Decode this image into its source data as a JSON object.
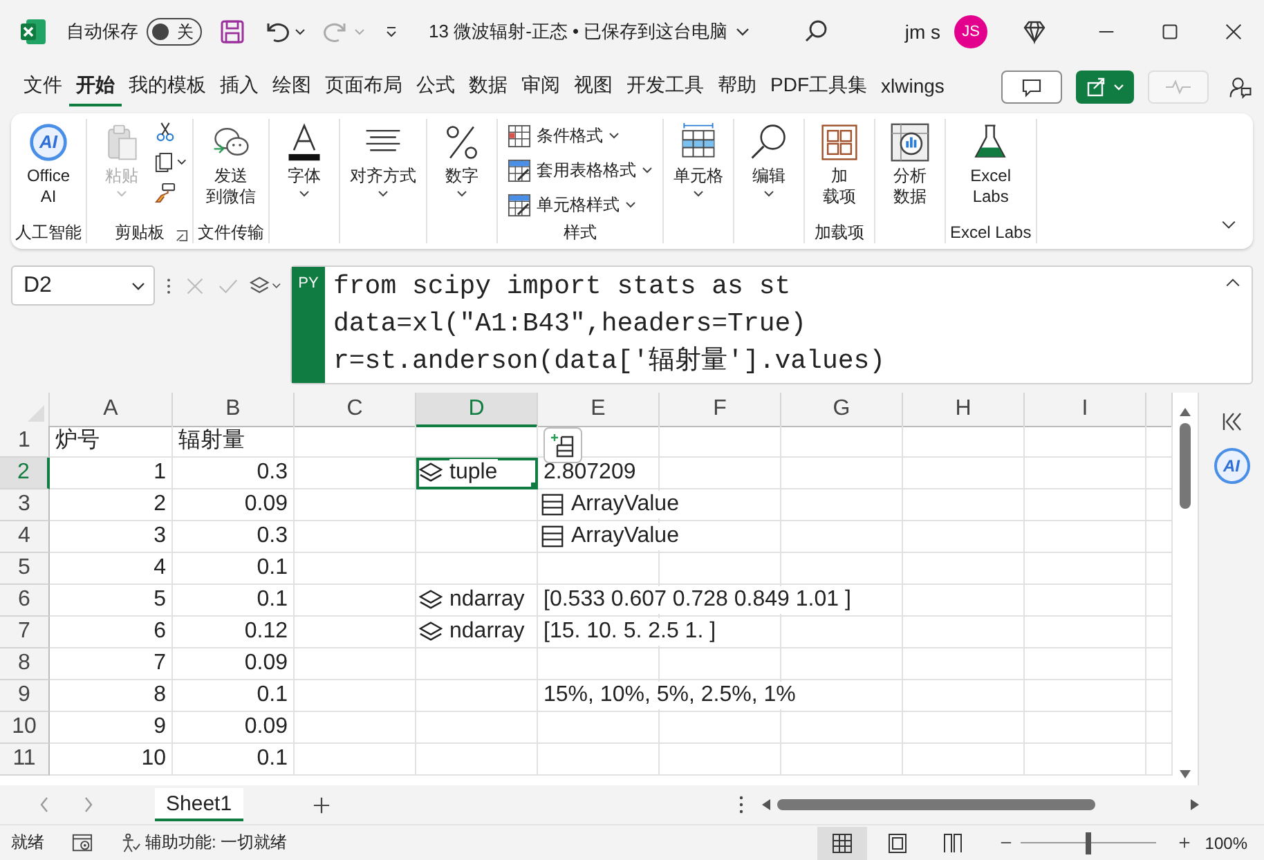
{
  "title_bar": {
    "autosave_label": "自动保存",
    "autosave": {
      "label": "关",
      "on": false
    },
    "document_title": "13 微波辐射-正态 • 已保存到这台电脑",
    "user_name": "jm s",
    "avatar": "JS"
  },
  "menu_tabs": [
    {
      "label": "文件",
      "selected": false
    },
    {
      "label": "开始",
      "selected": true
    },
    {
      "label": "我的模板",
      "selected": false
    },
    {
      "label": "插入",
      "selected": false
    },
    {
      "label": "绘图",
      "selected": false
    },
    {
      "label": "页面布局",
      "selected": false
    },
    {
      "label": "公式",
      "selected": false
    },
    {
      "label": "数据",
      "selected": false
    },
    {
      "label": "审阅",
      "selected": false
    },
    {
      "label": "视图",
      "selected": false
    },
    {
      "label": "开发工具",
      "selected": false
    },
    {
      "label": "帮助",
      "selected": false
    },
    {
      "label": "PDF工具集",
      "selected": false
    },
    {
      "label": "xlwings",
      "selected": false
    }
  ],
  "ribbon": {
    "groups": [
      {
        "label": "人工智能",
        "buttons": [
          {
            "lines": [
              "Office",
              "AI"
            ],
            "badge": "AI",
            "dropdown": false,
            "disabled": false
          }
        ]
      },
      {
        "label": "剪贴板",
        "buttons": [
          {
            "lines": [
              "粘贴"
            ],
            "dropdown": true,
            "disabled": true
          }
        ]
      },
      {
        "label": "文件传输",
        "buttons": [
          {
            "lines": [
              "发送",
              "到微信"
            ],
            "dropdown": false,
            "disabled": false
          }
        ]
      },
      {
        "buttons": [
          {
            "lines": [
              "字体"
            ],
            "dropdown": true,
            "disabled": false
          }
        ]
      },
      {
        "buttons": [
          {
            "lines": [
              "对齐方式"
            ],
            "dropdown": true,
            "disabled": false
          }
        ]
      },
      {
        "buttons": [
          {
            "lines": [
              "数字"
            ],
            "dropdown": true,
            "disabled": false
          }
        ]
      },
      {
        "label": "样式",
        "buttons": [
          {
            "lines": [
              "条件格式"
            ],
            "dropdown": true,
            "disabled": false
          },
          {
            "lines": [
              "套用表格格式"
            ],
            "dropdown": true,
            "disabled": false
          },
          {
            "lines": [
              "单元格样式"
            ],
            "dropdown": true,
            "disabled": false
          }
        ]
      },
      {
        "buttons": [
          {
            "lines": [
              "单元格"
            ],
            "dropdown": true,
            "disabled": false
          }
        ]
      },
      {
        "buttons": [
          {
            "lines": [
              "编辑"
            ],
            "dropdown": true,
            "disabled": false
          }
        ]
      },
      {
        "label": "加载项",
        "buttons": [
          {
            "lines": [
              "加",
              "载项"
            ],
            "dropdown": false,
            "disabled": false
          }
        ]
      },
      {
        "buttons": [
          {
            "lines": [
              "分析",
              "数据"
            ],
            "dropdown": false,
            "disabled": false
          }
        ]
      },
      {
        "label": "Excel Labs",
        "buttons": [
          {
            "lines": [
              "Excel",
              "Labs"
            ],
            "dropdown": false,
            "disabled": false
          }
        ]
      }
    ]
  },
  "formula_bar": {
    "name_box": "D2",
    "badge": "PY",
    "code_lines": [
      "from scipy import stats as st",
      "data=xl(\"A1:B43\",headers=True)",
      "r=st.anderson(data['辐射量'].values)"
    ]
  },
  "columns": [
    {
      "label": "A",
      "selected": false
    },
    {
      "label": "B",
      "selected": false
    },
    {
      "label": "C",
      "selected": false
    },
    {
      "label": "D",
      "selected": true
    },
    {
      "label": "E",
      "selected": false
    },
    {
      "label": "F",
      "selected": false
    },
    {
      "label": "G",
      "selected": false
    },
    {
      "label": "H",
      "selected": false
    },
    {
      "label": "I",
      "selected": false
    }
  ],
  "rows": [
    {
      "header": "1",
      "selected": false,
      "cells": [
        {
          "kind": "text",
          "text": "炉号"
        },
        {
          "kind": "text",
          "text": "辐射量"
        },
        {
          "kind": "empty"
        },
        {
          "kind": "empty"
        },
        {
          "kind": "empty"
        },
        {
          "kind": "empty"
        },
        {
          "kind": "empty"
        },
        {
          "kind": "empty"
        },
        {
          "kind": "empty"
        }
      ]
    },
    {
      "header": "2",
      "selected": true,
      "cells": [
        {
          "kind": "number",
          "text": "1"
        },
        {
          "kind": "number",
          "text": "0.3"
        },
        {
          "kind": "empty"
        },
        {
          "kind": "tuple",
          "text": "tuple"
        },
        {
          "kind": "text",
          "text": "2.807209"
        },
        {
          "kind": "empty"
        },
        {
          "kind": "empty"
        },
        {
          "kind": "empty"
        },
        {
          "kind": "empty"
        }
      ]
    },
    {
      "header": "3",
      "selected": false,
      "cells": [
        {
          "kind": "number",
          "text": "2"
        },
        {
          "kind": "number",
          "text": "0.09"
        },
        {
          "kind": "empty"
        },
        {
          "kind": "empty"
        },
        {
          "kind": "array",
          "text": "ArrayValue"
        },
        {
          "kind": "empty"
        },
        {
          "kind": "empty"
        },
        {
          "kind": "empty"
        },
        {
          "kind": "empty"
        }
      ]
    },
    {
      "header": "4",
      "selected": false,
      "cells": [
        {
          "kind": "number",
          "text": "3"
        },
        {
          "kind": "number",
          "text": "0.3"
        },
        {
          "kind": "empty"
        },
        {
          "kind": "empty"
        },
        {
          "kind": "array",
          "text": "ArrayValue"
        },
        {
          "kind": "empty"
        },
        {
          "kind": "empty"
        },
        {
          "kind": "empty"
        },
        {
          "kind": "empty"
        }
      ]
    },
    {
      "header": "5",
      "selected": false,
      "cells": [
        {
          "kind": "number",
          "text": "4"
        },
        {
          "kind": "number",
          "text": "0.1"
        },
        {
          "kind": "empty"
        },
        {
          "kind": "empty"
        },
        {
          "kind": "empty"
        },
        {
          "kind": "empty"
        },
        {
          "kind": "empty"
        },
        {
          "kind": "empty"
        },
        {
          "kind": "empty"
        }
      ]
    },
    {
      "header": "6",
      "selected": false,
      "cells": [
        {
          "kind": "number",
          "text": "5"
        },
        {
          "kind": "number",
          "text": "0.1"
        },
        {
          "kind": "empty"
        },
        {
          "kind": "tuple",
          "text": "ndarray"
        },
        {
          "kind": "text",
          "text": "[0.533 0.607 0.728 0.849 1.01 ]"
        },
        {
          "kind": "empty"
        },
        {
          "kind": "empty"
        },
        {
          "kind": "empty"
        },
        {
          "kind": "empty"
        }
      ]
    },
    {
      "header": "7",
      "selected": false,
      "cells": [
        {
          "kind": "number",
          "text": "6"
        },
        {
          "kind": "number",
          "text": "0.12"
        },
        {
          "kind": "empty"
        },
        {
          "kind": "tuple",
          "text": "ndarray"
        },
        {
          "kind": "text",
          "text": "[15.  10.   5.   2.5  1. ]"
        },
        {
          "kind": "empty"
        },
        {
          "kind": "empty"
        },
        {
          "kind": "empty"
        },
        {
          "kind": "empty"
        }
      ]
    },
    {
      "header": "8",
      "selected": false,
      "cells": [
        {
          "kind": "number",
          "text": "7"
        },
        {
          "kind": "number",
          "text": "0.09"
        },
        {
          "kind": "empty"
        },
        {
          "kind": "empty"
        },
        {
          "kind": "empty"
        },
        {
          "kind": "empty"
        },
        {
          "kind": "empty"
        },
        {
          "kind": "empty"
        },
        {
          "kind": "empty"
        }
      ]
    },
    {
      "header": "9",
      "selected": false,
      "cells": [
        {
          "kind": "number",
          "text": "8"
        },
        {
          "kind": "number",
          "text": "0.1"
        },
        {
          "kind": "empty"
        },
        {
          "kind": "empty"
        },
        {
          "kind": "text",
          "text": "15%, 10%, 5%, 2.5%, 1%"
        },
        {
          "kind": "empty"
        },
        {
          "kind": "empty"
        },
        {
          "kind": "empty"
        },
        {
          "kind": "empty"
        }
      ]
    },
    {
      "header": "10",
      "selected": false,
      "cells": [
        {
          "kind": "number",
          "text": "9"
        },
        {
          "kind": "number",
          "text": "0.09"
        },
        {
          "kind": "empty"
        },
        {
          "kind": "empty"
        },
        {
          "kind": "empty"
        },
        {
          "kind": "empty"
        },
        {
          "kind": "empty"
        },
        {
          "kind": "empty"
        },
        {
          "kind": "empty"
        }
      ]
    },
    {
      "header": "11",
      "selected": false,
      "cells": [
        {
          "kind": "number",
          "text": "10"
        },
        {
          "kind": "number",
          "text": "0.1"
        },
        {
          "kind": "empty"
        },
        {
          "kind": "empty"
        },
        {
          "kind": "empty"
        },
        {
          "kind": "empty"
        },
        {
          "kind": "empty"
        },
        {
          "kind": "empty"
        },
        {
          "kind": "empty"
        }
      ]
    }
  ],
  "side_pane": {
    "ai_badge": "AI"
  },
  "sheets": [
    {
      "label": "Sheet1",
      "selected": true
    }
  ],
  "status_bar": {
    "ready": "就绪",
    "accessibility": "辅助功能: 一切就绪",
    "views": [
      {
        "selected": true
      },
      {
        "selected": false
      },
      {
        "selected": false
      }
    ],
    "zoom": {
      "level": 0.5,
      "label": "100%"
    }
  }
}
